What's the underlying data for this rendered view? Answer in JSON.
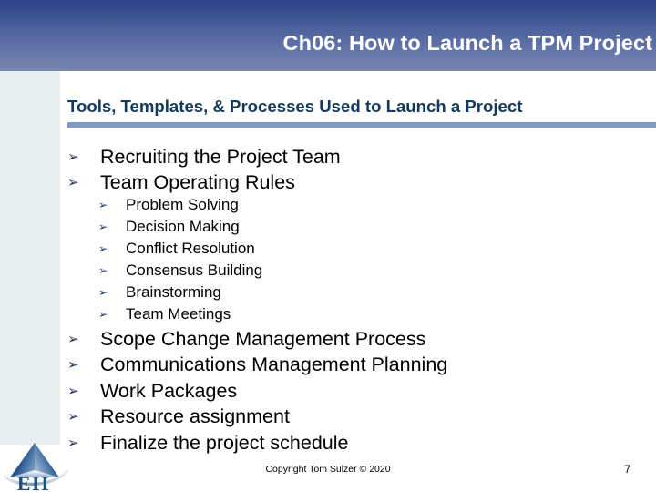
{
  "slide": {
    "title": "Ch06: How to Launch a TPM Project",
    "subtitle": "Tools, Templates, & Processes Used to Launch a Project",
    "page_number": "7",
    "copyright": "Copyright Tom Sulzer © 2020"
  },
  "theme": {
    "header_gradient_top": "#2d4386",
    "header_gradient_bottom": "#7886b2",
    "subtitle_color": "#123a5e",
    "rule_color": "#8099c8",
    "accent_column_color": "#e9eef1",
    "body_text_color": "#000000",
    "bullet_marker_color": "#1f3864",
    "logo_blue": "#1f4e79"
  },
  "bullets": {
    "marker_glyph": "➢",
    "level1_top": [
      {
        "text": "Recruiting the Project Team"
      },
      {
        "text": "Team Operating Rules"
      }
    ],
    "level2": [
      {
        "text": "Problem Solving"
      },
      {
        "text": "Decision Making"
      },
      {
        "text": "Conflict Resolution"
      },
      {
        "text": "Consensus Building"
      },
      {
        "text": "Brainstorming"
      },
      {
        "text": "Team Meetings"
      }
    ],
    "level1_bottom": [
      {
        "text": "Scope Change Management Process"
      },
      {
        "text": "Communications Management Planning"
      },
      {
        "text": "Work Packages"
      },
      {
        "text": "Resource assignment"
      },
      {
        "text": "Finalize the project schedule"
      }
    ]
  },
  "logo": {
    "name": "eii-pyramid-logo",
    "wordmark": "EII"
  }
}
